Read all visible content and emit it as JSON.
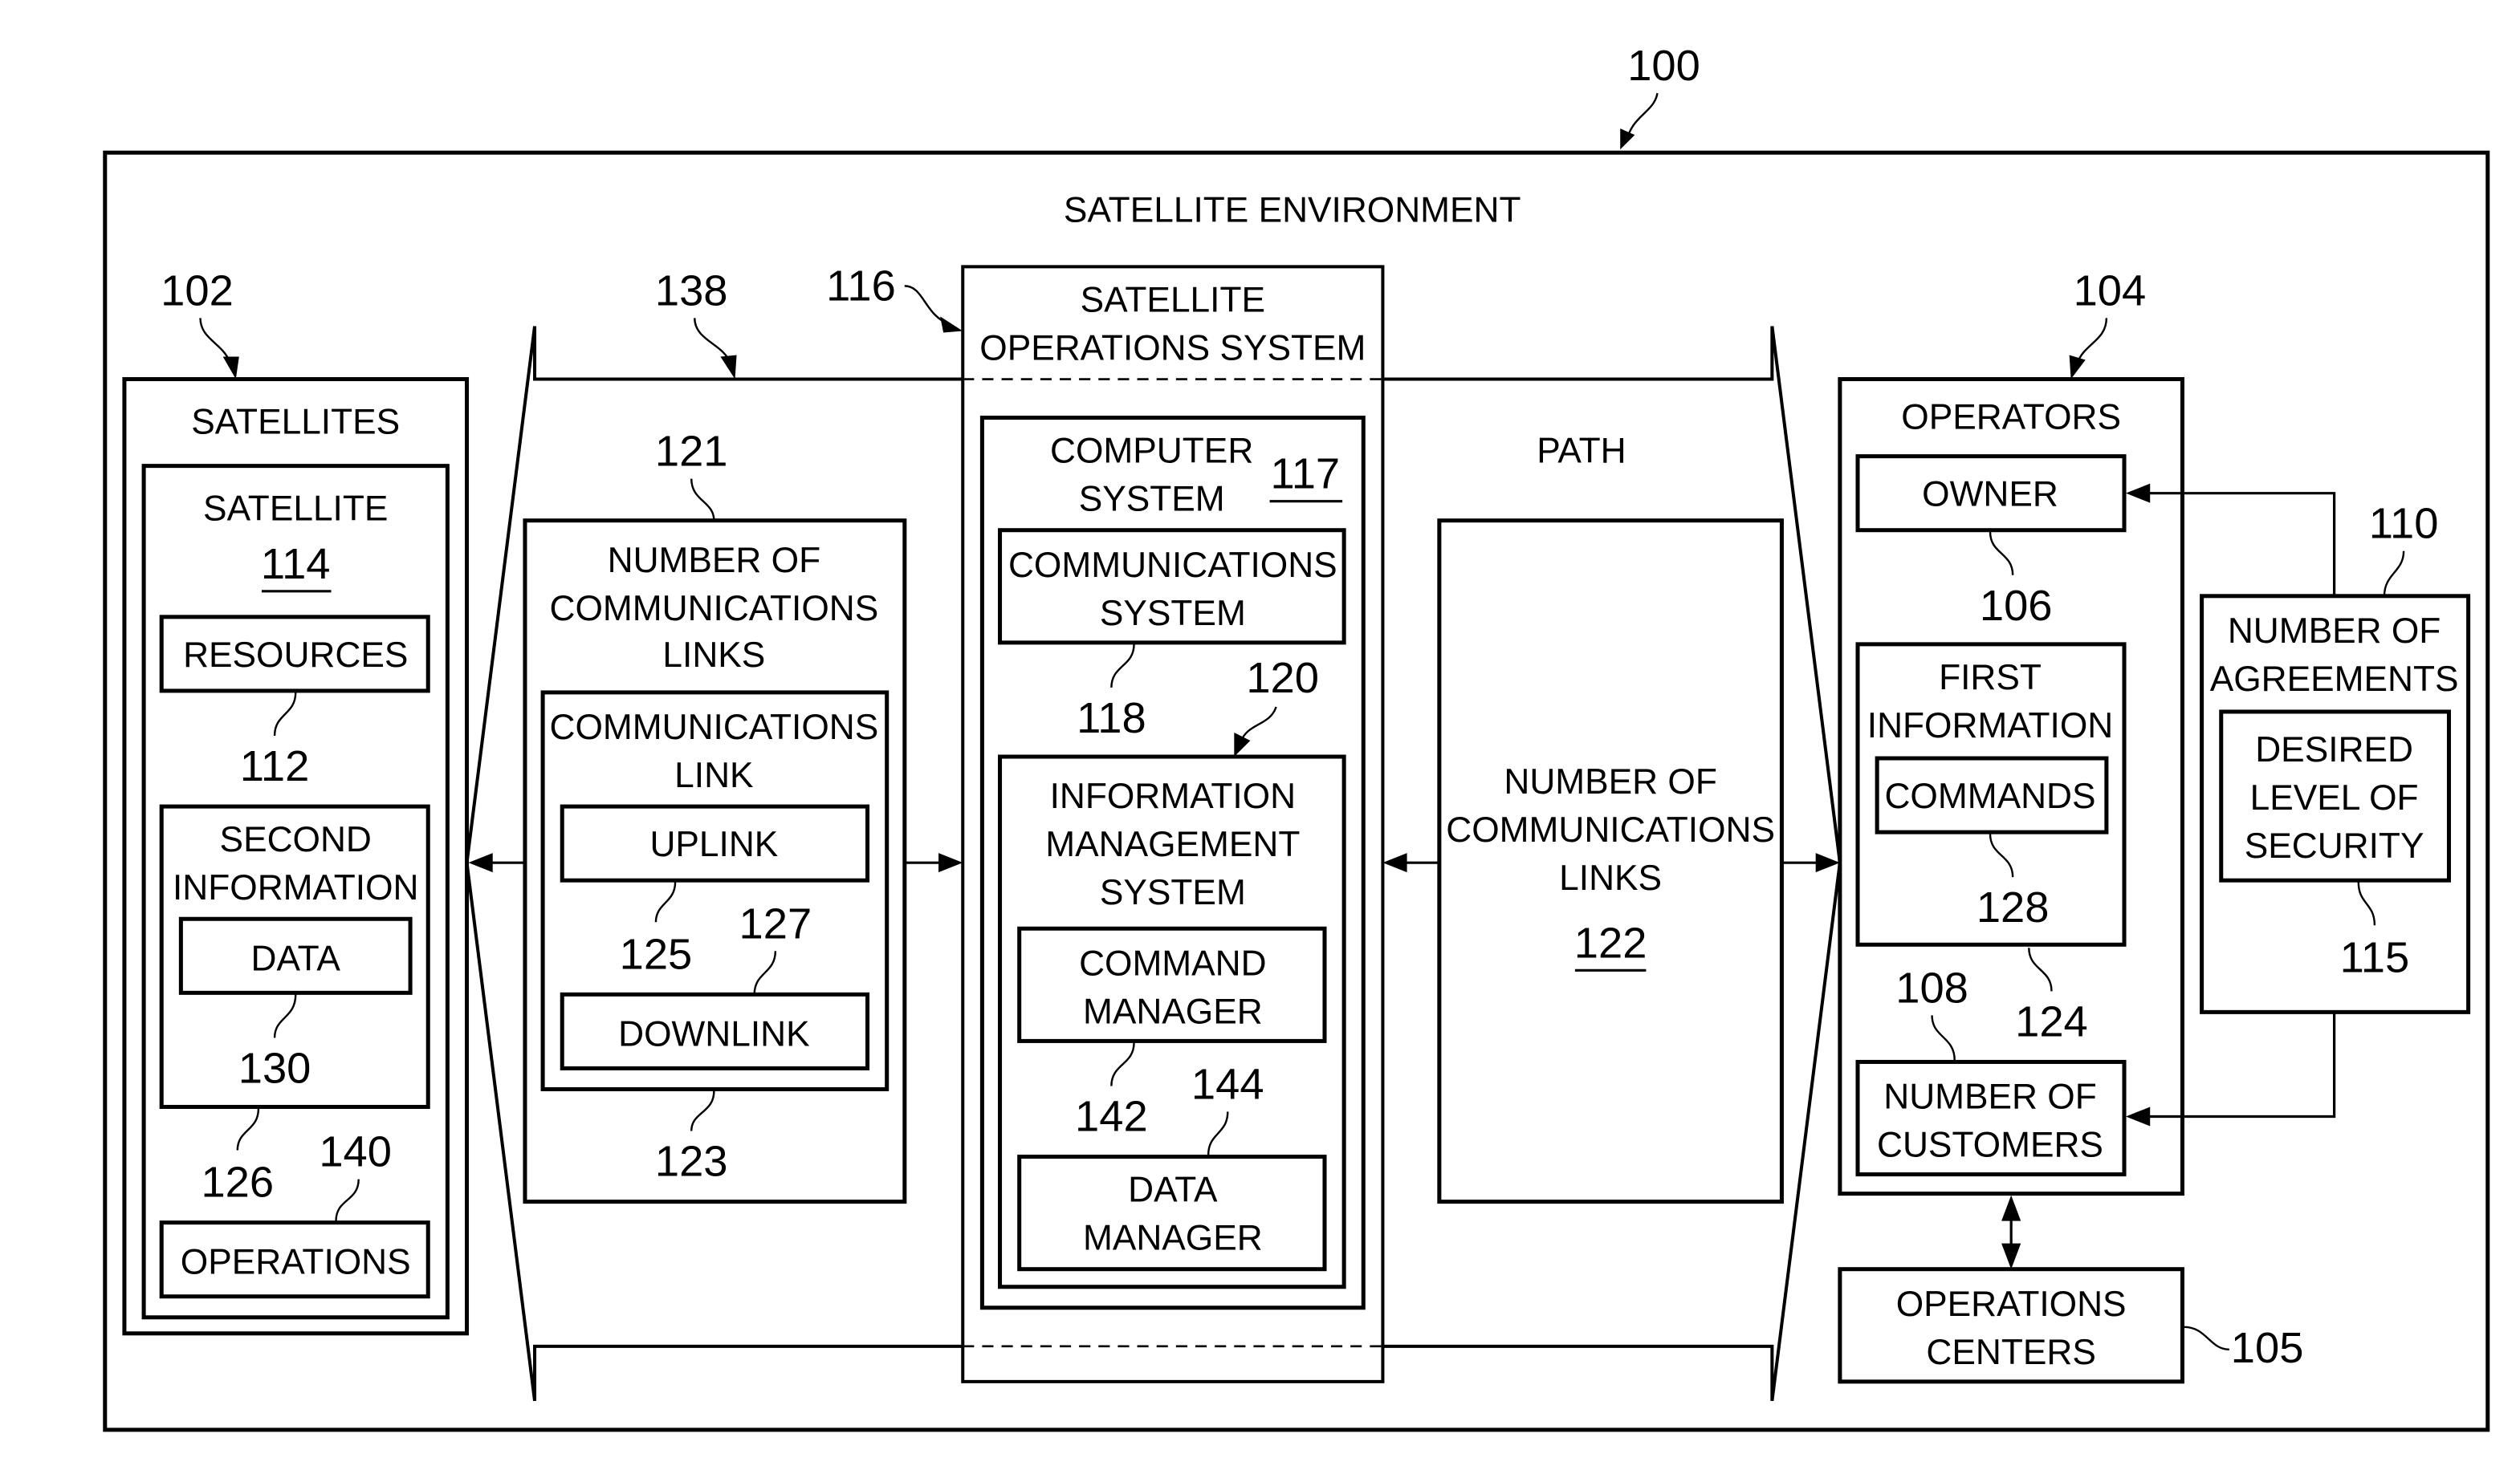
{
  "figure": {
    "ref": "100",
    "title": "SATELLITE ENVIRONMENT"
  },
  "satellites": {
    "ref": "102",
    "title": "SATELLITES",
    "satellite": {
      "title": "SATELLITE",
      "ref": "114",
      "resources": {
        "label": "RESOURCES",
        "ref": "112"
      },
      "second_information": {
        "title_line1": "SECOND",
        "title_line2": "INFORMATION",
        "ref": "126",
        "data": {
          "label": "DATA",
          "ref": "130"
        }
      },
      "operations": {
        "label": "OPERATIONS",
        "ref": "140"
      }
    }
  },
  "links_group": {
    "ref": "138",
    "box": {
      "ref": "121",
      "title_line1": "NUMBER OF",
      "title_line2": "COMMUNICATIONS",
      "title_line3": "LINKS",
      "link": {
        "ref": "123",
        "title_line1": "COMMUNICATIONS",
        "title_line2": "LINK",
        "uplink": {
          "label": "UPLINK",
          "ref": "125"
        },
        "downlink": {
          "label": "DOWNLINK",
          "ref": "127"
        }
      }
    }
  },
  "sat_ops_system": {
    "ref": "116",
    "title_line1": "SATELLITE",
    "title_line2": "OPERATIONS SYSTEM",
    "computer_system": {
      "title_line1": "COMPUTER",
      "title_line2": "SYSTEM",
      "ref": "117",
      "comms_system": {
        "label_line1": "COMMUNICATIONS",
        "label_line2": "SYSTEM",
        "ref": "118"
      },
      "info_mgmt": {
        "ref": "120",
        "title_line1": "INFORMATION",
        "title_line2": "MANAGEMENT",
        "title_line3": "SYSTEM",
        "command_manager": {
          "label_line1": "COMMAND",
          "label_line2": "MANAGER",
          "ref": "142"
        },
        "data_manager": {
          "label_line1": "DATA",
          "label_line2": "MANAGER",
          "ref": "144"
        }
      }
    }
  },
  "path": {
    "title": "PATH",
    "box": {
      "title_line1": "NUMBER OF",
      "title_line2": "COMMUNICATIONS",
      "title_line3": "LINKS",
      "ref": "122"
    }
  },
  "operators": {
    "ref": "104",
    "title": "OPERATORS",
    "owner": {
      "label": "OWNER",
      "ref": "106"
    },
    "first_information": {
      "title_line1": "FIRST",
      "title_line2": "INFORMATION",
      "ref": "124",
      "commands": {
        "label": "COMMANDS",
        "ref": "128"
      }
    },
    "customers": {
      "label_line1": "NUMBER OF",
      "label_line2": "CUSTOMERS",
      "ref": "108"
    }
  },
  "agreements": {
    "ref": "110",
    "title_line1": "NUMBER OF",
    "title_line2": "AGREEMENTS",
    "security": {
      "label_line1": "DESIRED",
      "label_line2": "LEVEL OF",
      "label_line3": "SECURITY",
      "ref": "115"
    }
  },
  "operations_centers": {
    "label_line1": "OPERATIONS",
    "label_line2": "CENTERS",
    "ref": "105"
  }
}
